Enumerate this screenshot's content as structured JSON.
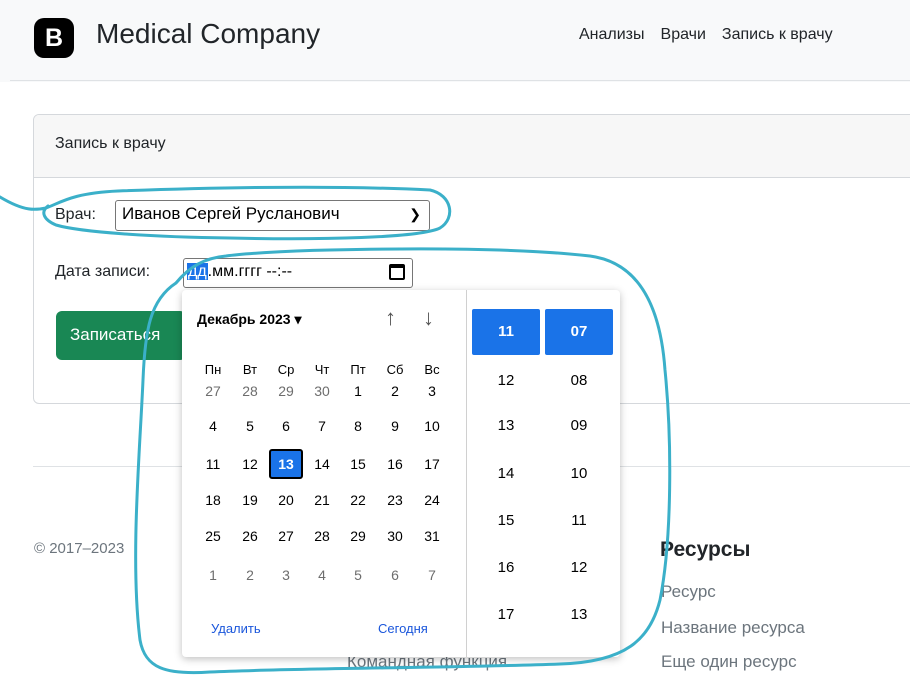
{
  "navbar": {
    "brand_letter": "B",
    "brand_name": "Medical Company",
    "links": [
      "Анализы",
      "Врачи",
      "Запись к врачу"
    ]
  },
  "card": {
    "header": "Запись к врачу",
    "doctor_label": "Врач:",
    "doctor_value": "Иванов Сергей Русланович",
    "date_label": "Дата записи:",
    "date_placeholder_highlighted": "дд",
    "date_placeholder_rest": ".мм.гггг --:--",
    "submit_label": "Записаться"
  },
  "footer": {
    "copyright": "© 2017–2023",
    "resources_title": "Ресурсы",
    "resource_links": [
      "Ресурс",
      "Название ресурса",
      "Еще один ресурс"
    ],
    "command_function": "Командная функция"
  },
  "datepicker": {
    "month_label": "Декабрь 2023 ▾",
    "up_arrow": "↑",
    "down_arrow": "↓",
    "weekdays": [
      "Пн",
      "Вт",
      "Ср",
      "Чт",
      "Пт",
      "Сб",
      "Вс"
    ],
    "weeks": [
      [
        "27",
        "28",
        "29",
        "30",
        "1",
        "2",
        "3"
      ],
      [
        "4",
        "5",
        "6",
        "7",
        "8",
        "9",
        "10"
      ],
      [
        "11",
        "12",
        "13",
        "14",
        "15",
        "16",
        "17"
      ],
      [
        "18",
        "19",
        "20",
        "21",
        "22",
        "23",
        "24"
      ],
      [
        "25",
        "26",
        "27",
        "28",
        "29",
        "30",
        "31"
      ],
      [
        "1",
        "2",
        "3",
        "4",
        "5",
        "6",
        "7"
      ]
    ],
    "selected_day": "13",
    "clear_label": "Удалить",
    "today_label": "Сегодня",
    "hours": [
      "11",
      "12",
      "13",
      "14",
      "15",
      "16",
      "17"
    ],
    "minutes": [
      "07",
      "08",
      "09",
      "10",
      "11",
      "12",
      "13"
    ],
    "selected_hour": "11",
    "selected_minute": "07"
  },
  "colors": {
    "primary": "#1a73e8",
    "success": "#198754",
    "annotation": "#3bb0c9"
  }
}
